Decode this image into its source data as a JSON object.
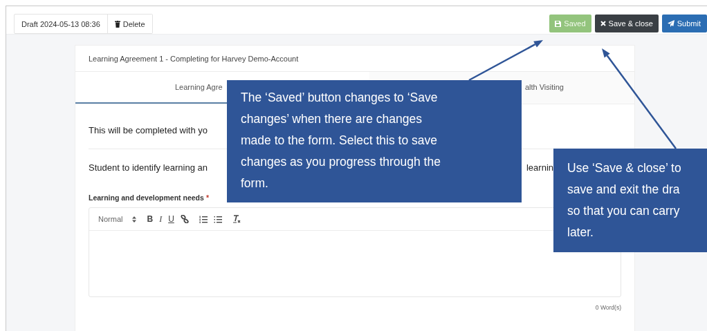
{
  "toolbar": {
    "draft_label": "Draft 2024-05-13 08:36",
    "delete_button": "Delete",
    "actions": [
      {
        "kind": "saved",
        "label": "Saved",
        "disabled": true
      },
      {
        "kind": "close",
        "label": "Save & close",
        "disabled": false
      },
      {
        "kind": "submit",
        "label": "Submit",
        "disabled": false
      }
    ]
  },
  "card": {
    "title": "Learning Agreement 1 - Completing for Harvey Demo-Account",
    "tabs": [
      {
        "label": "Learning Agre",
        "selected": true
      },
      {
        "label": "alth Visiting",
        "selected": false
      }
    ],
    "intro": "This will be completed with yo",
    "prompt": [
      "Student to identify learning an",
      "learnin"
    ],
    "field": {
      "label": "Learning and development needs",
      "required_mark": "*",
      "toolbar": [
        {
          "kind": "select",
          "label": "Normal"
        },
        {
          "kind": "bold",
          "label": "B"
        },
        {
          "kind": "italic",
          "label": "I"
        },
        {
          "kind": "underline",
          "label": "U"
        },
        {
          "kind": "link"
        },
        {
          "kind": "ordered-list"
        },
        {
          "kind": "bullet-list"
        },
        {
          "kind": "clear-format"
        }
      ],
      "word_count": "0 Word(s)"
    }
  },
  "callouts": [
    {
      "text": "The ‘Saved’ button changes to ‘Save\nchanges’ when there are changes\nmade to the form. Select this to save\nchanges as you progress through the\nform."
    },
    {
      "text": "Use ‘Save & close’ to\nsave and exit the dra\nso that you can carry\nlater."
    }
  ]
}
